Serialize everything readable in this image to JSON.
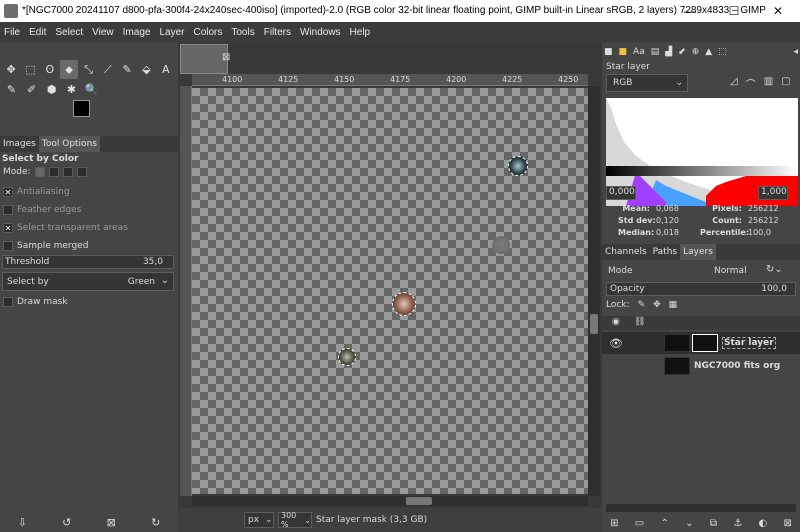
{
  "window": {
    "title": "*[NGC7000 20241107 d800-pfa-300f4-24x240sec-400iso] (imported)-2.0 (RGB color 32-bit linear floating point, GIMP built-in Linear sRGB, 2 layers) 7289x4833 – GIMP",
    "minimize": "—",
    "maximize": "☐",
    "close": "✕"
  },
  "menu": [
    "File",
    "Edit",
    "Select",
    "View",
    "Image",
    "Layer",
    "Colors",
    "Tools",
    "Filters",
    "Windows",
    "Help"
  ],
  "toolbox": {
    "row1": [
      "✥",
      "⬚",
      "ʘ",
      "⬥",
      "⤡",
      "⟋",
      "✎",
      "⬙",
      "A"
    ],
    "row2": [
      "✎",
      "✐",
      "⬢",
      "✱",
      "🔍"
    ]
  },
  "left_dock": {
    "tabs": [
      "Images",
      "Tool Options"
    ],
    "tool_title": "Select by Color",
    "mode_label": "Mode:",
    "antialiasing": "Antialiasing",
    "feather": "Feather edges",
    "select_transparent": "Select transparent areas",
    "sample_merged": "Sample merged",
    "threshold_label": "Threshold",
    "threshold_value": "35,0",
    "select_by_label": "Select by",
    "select_by_value": "Green",
    "draw_mask": "Draw mask"
  },
  "ruler": {
    "ticks": [
      "4100",
      "4125",
      "4150",
      "4175",
      "4200",
      "4225",
      "4250"
    ]
  },
  "status": {
    "unit": "px",
    "zoom": "300 %",
    "message": "Star layer mask (3,3 GB)"
  },
  "right_dock": {
    "layer_name_header": "Star layer",
    "channel": "RGB",
    "range_low": "0,000",
    "range_high": "1,000",
    "stats": {
      "mean_label": "Mean:",
      "mean": "0,068",
      "stddev_label": "Std dev:",
      "stddev": "0,120",
      "median_label": "Median:",
      "median": "0,018",
      "pixels_label": "Pixels:",
      "pixels": "256212",
      "count_label": "Count:",
      "count": "256212",
      "percentile_label": "Percentile:",
      "percentile": "100,0"
    },
    "tabs": [
      "Channels",
      "Paths",
      "Layers"
    ],
    "mode_label": "Mode",
    "mode_value": "Normal",
    "opacity_label": "Opacity",
    "opacity_value": "100,0",
    "lock_label": "Lock:",
    "layers": [
      {
        "name": "Star layer"
      },
      {
        "name": "NGC7000 fits org"
      }
    ]
  }
}
